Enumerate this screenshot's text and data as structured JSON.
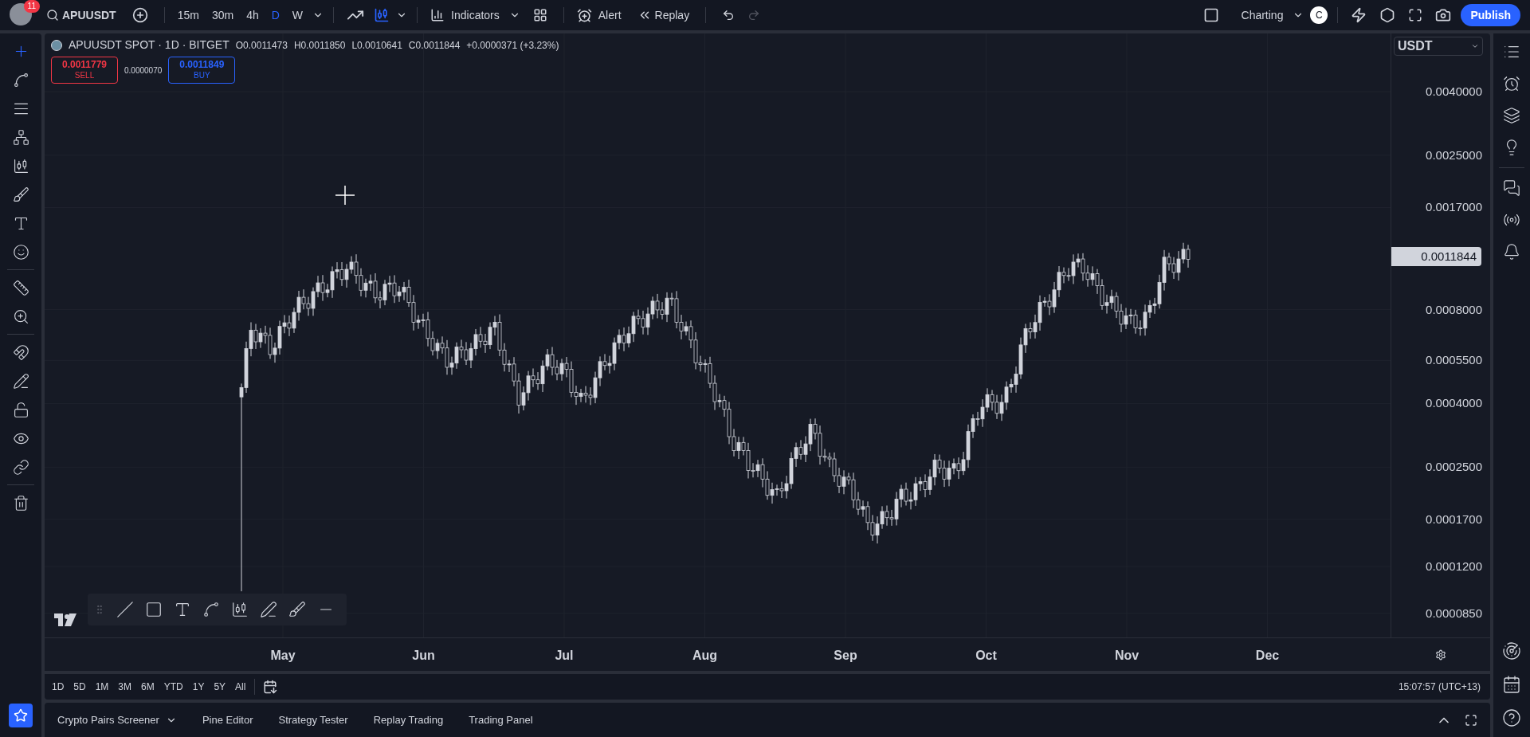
{
  "topbar": {
    "avatar_badge": "11",
    "symbol": "APUUSDT",
    "intervals": [
      {
        "label": "15m",
        "selected": false
      },
      {
        "label": "30m",
        "selected": false
      },
      {
        "label": "4h",
        "selected": false
      },
      {
        "label": "D",
        "selected": true
      },
      {
        "label": "W",
        "selected": false
      }
    ],
    "indicators": "Indicators",
    "alert": "Alert",
    "replay": "Replay",
    "layout": "Charting",
    "layout_initial": "C",
    "publish": "Publish"
  },
  "legend": {
    "title": "APUUSDT SPOT · 1D · BITGET",
    "ohlc": [
      "O0.0011473",
      "H0.0011850",
      "L0.0010641",
      "C0.0011844"
    ],
    "change": "+0.0000371 (+3.23%)"
  },
  "trade": {
    "sell_price": "0.0011779",
    "sell": "SELL",
    "spread": "0.0000070",
    "buy_price": "0.0011849",
    "buy": "BUY"
  },
  "currency": "USDT",
  "price_axis": [
    "0.0040000",
    "0.0025000",
    "0.0017000",
    "0.0008000",
    "0.0005500",
    "0.0004000",
    "0.0002500",
    "0.0001700",
    "0.0001200",
    "0.0000850"
  ],
  "last_price": "0.0011844",
  "time_axis": [
    "May",
    "Jun",
    "Jul",
    "Aug",
    "Sep",
    "Oct",
    "Nov",
    "Dec"
  ],
  "left_tools": [
    {
      "kind": "crosshair",
      "selected": true
    },
    {
      "kind": "trendline",
      "selected": false
    },
    {
      "kind": "fib",
      "selected": false
    },
    {
      "kind": "pattern",
      "selected": false
    },
    {
      "kind": "forecast",
      "selected": false
    },
    {
      "kind": "brush",
      "selected": false
    },
    {
      "kind": "text",
      "selected": false
    },
    {
      "kind": "emoji",
      "selected": false
    },
    {
      "kind": "ruler",
      "selected": false
    },
    {
      "kind": "zoom",
      "selected": false
    },
    {
      "kind": "magnet",
      "selected": false
    },
    {
      "kind": "lockdraw",
      "selected": false
    },
    {
      "kind": "lock",
      "selected": false
    },
    {
      "kind": "eye",
      "selected": false
    },
    {
      "kind": "link",
      "selected": false
    },
    {
      "kind": "trash",
      "selected": false
    }
  ],
  "ranges": [
    "1D",
    "5D",
    "1M",
    "3M",
    "6M",
    "YTD",
    "1Y",
    "5Y",
    "All"
  ],
  "clock": "15:07:57 (UTC+13)",
  "bottom_tabs": [
    "Crypto Pairs Screener",
    "Pine Editor",
    "Strategy Tester",
    "Replay Trading",
    "Trading Panel"
  ]
}
